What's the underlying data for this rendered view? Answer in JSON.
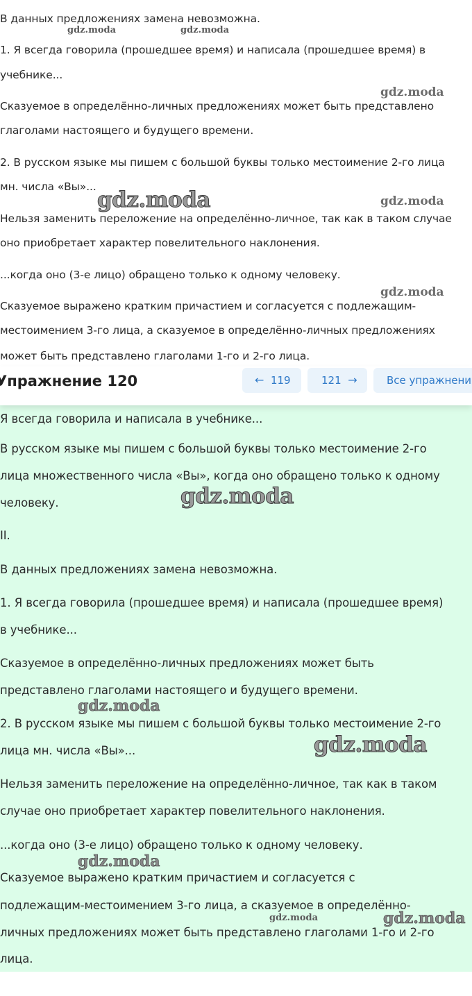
{
  "top_solution": {
    "lines": [
      "В данных предложениях замена невозможна.",
      "1. Я всегда говорила (прошедшее время) и написала (прошедшее время) в",
      "учебнике...",
      "Сказуемое в определённо-личных предложениях может быть представлено",
      "глаголами настоящего и будущего времени.",
      "2. В русском языке мы пишем с большой буквы только местоимение 2-го лица",
      "мн. числа «Вы»...",
      "Нельзя заменить переложение на определённо-личное, так как в таком случае",
      "оно приобретает характер повелительного наклонения.",
      "...когда оно (3-е лицо) обращено только к одному человеку.",
      "Сказуемое выражено кратким причастием и согласуется с подлежащим-",
      "местоимением 3-го лица, а сказуемое в определённо-личных предложениях",
      "может быть представлено глаголами 1-го и 2-го лица."
    ]
  },
  "nav": {
    "title": "Упражнение 120",
    "prev_arrow": "←",
    "prev_label": "119",
    "next_label": "121",
    "next_arrow": "→",
    "all_label": "Все упражнения"
  },
  "green_solution": {
    "lines": [
      "Я всегда говорила и написала в учебнике...",
      "В русском языке мы пишем с большой буквы только местоимение 2-го",
      "лица множественного числа «Вы», когда оно обращено только к одному",
      "человеку.",
      "II.",
      "В данных предложениях замена невозможна.",
      "1. Я всегда говорила (прошедшее время) и написала (прошедшее время)",
      "в учебнике...",
      "Сказуемое в определённо-личных предложениях может быть",
      "представлено глаголами настоящего и будущего времени.",
      "2. В русском языке мы пишем с большой буквы только местоимение 2-го",
      "лица мн. числа «Вы»...",
      "Нельзя заменить переложение на определённо-личное, так как в таком",
      "случае оно приобретает характер повелительного наклонения.",
      "...когда оно (3-е лицо) обращено только к одному человеку.",
      "Сказуемое выражено кратким причастием и согласуется с",
      "подлежащим-местоимением 3-го лица, а сказуемое в определённо-",
      "личных предложениях может быть представлено глаголами 1-го и 2-го",
      "лица."
    ]
  },
  "watermark": {
    "text": "gdz.moda"
  }
}
